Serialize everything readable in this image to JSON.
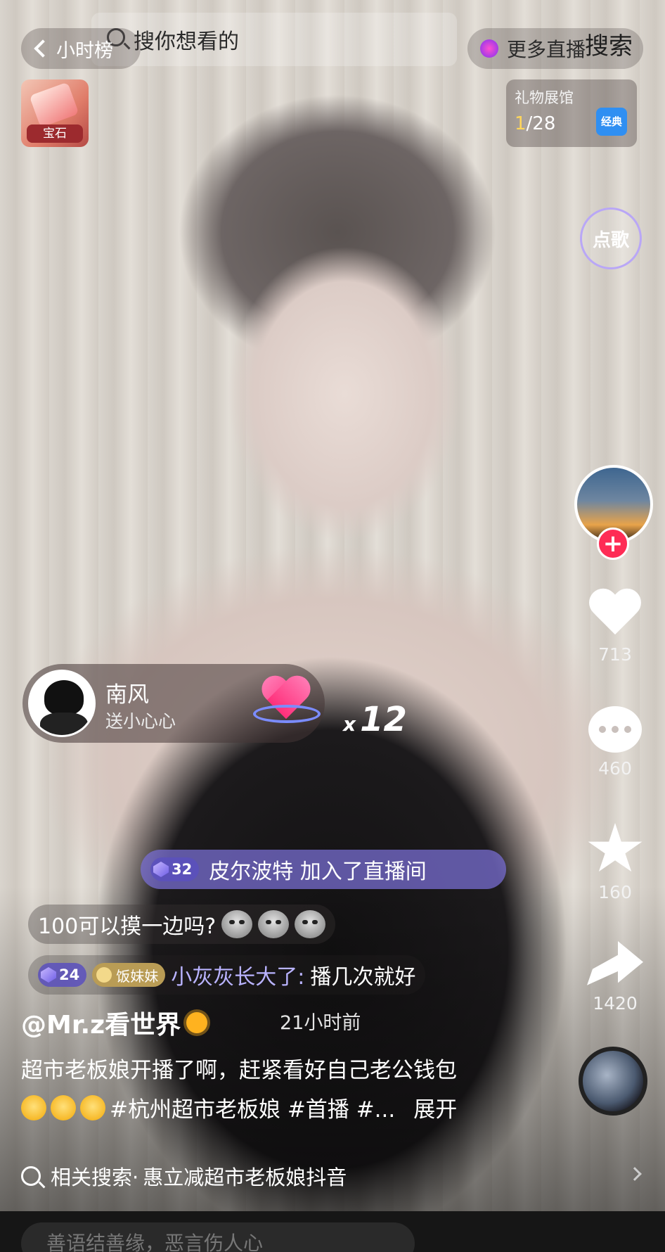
{
  "top": {
    "rank_label": "小时榜",
    "search_placeholder": "搜你想看的",
    "more_live": "更多直播",
    "search_action": "搜索"
  },
  "gem": {
    "label": "宝石"
  },
  "gift_hall": {
    "title": "礼物展馆",
    "current": "1",
    "total": "/28",
    "badge": "经典"
  },
  "song_button": "点歌",
  "right_rail": {
    "likes": "713",
    "comments": "460",
    "favorites": "160",
    "shares": "1420"
  },
  "gift_event": {
    "user": "南风",
    "action": "送小心心",
    "count_prefix": "x",
    "count": "12"
  },
  "join_notice": {
    "level": "32",
    "text": "皮尔波特 加入了直播间"
  },
  "chat": [
    {
      "message": "100可以摸一边吗?"
    },
    {
      "level": "24",
      "fan_badge": "饭妹妹",
      "name": "小灰灰长大了:",
      "message": "播几次就好"
    }
  ],
  "video": {
    "author": "@Mr.z看世界",
    "time": "21小时前",
    "caption": "超市老板娘开播了啊，赶紧看好自己老公钱包",
    "tags": "#杭州超市老板娘 #首播 #...",
    "expand": "展开"
  },
  "related_search": {
    "label": "相关搜索·",
    "query": "惠立减超市老板娘抖音"
  },
  "input": {
    "placeholder": "善语结善缘，恶言伤人心"
  },
  "colors": {
    "accent_pink": "#fe2c55",
    "join_purple": "#7868d2",
    "chat_name": "#b9b3ff"
  }
}
